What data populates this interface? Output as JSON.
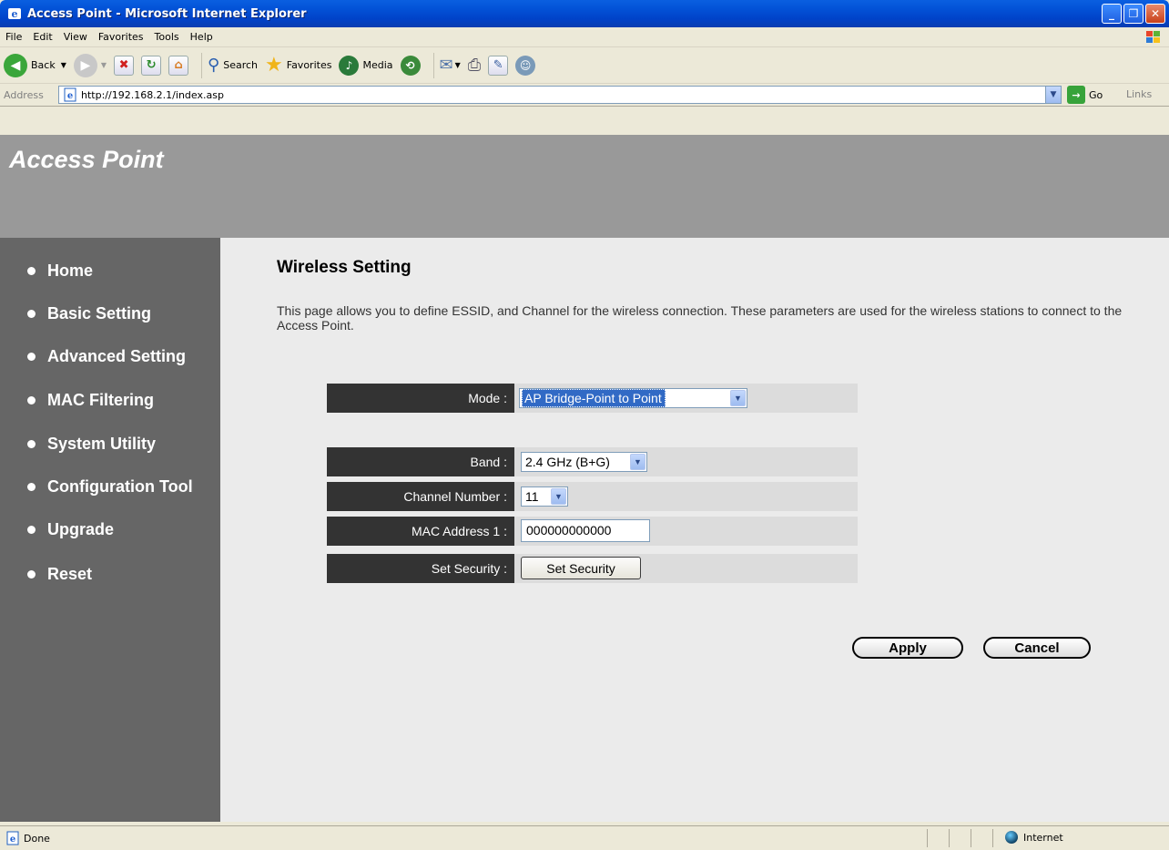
{
  "window": {
    "title": "Access Point - Microsoft Internet Explorer",
    "controls": [
      "minimize",
      "maximize",
      "close"
    ]
  },
  "menu": [
    "File",
    "Edit",
    "View",
    "Favorites",
    "Tools",
    "Help"
  ],
  "toolbar": {
    "back": "Back",
    "search": "Search",
    "favorites": "Favorites",
    "media": "Media"
  },
  "address": {
    "label": "Address",
    "url": "http://192.168.2.1/index.asp",
    "go": "Go",
    "links": "Links"
  },
  "banner": {
    "brand": "Access Point"
  },
  "nav": [
    {
      "label": "Home"
    },
    {
      "label": "Basic Setting"
    },
    {
      "label": "Advanced Setting"
    },
    {
      "label": "MAC Filtering"
    },
    {
      "label": "System Utility"
    },
    {
      "label": "Configuration Tool"
    },
    {
      "label": "Upgrade"
    },
    {
      "label": "Reset"
    }
  ],
  "content": {
    "title": "Wireless Setting",
    "description": "This page allows you to define ESSID, and Channel for the wireless connection. These parameters are used for the wireless stations to connect to the Access Point."
  },
  "form": {
    "mode": {
      "label": "Mode :",
      "value": "AP Bridge-Point to Point"
    },
    "band": {
      "label": "Band :",
      "value": "2.4 GHz (B+G)"
    },
    "channel": {
      "label": "Channel Number :",
      "value": "11"
    },
    "mac1": {
      "label": "MAC Address 1 :",
      "value": "000000000000"
    },
    "security": {
      "label": "Set Security :",
      "button": "Set Security"
    }
  },
  "actions": {
    "apply": "Apply",
    "cancel": "Cancel"
  },
  "status": {
    "text": "Done",
    "zone": "Internet"
  }
}
